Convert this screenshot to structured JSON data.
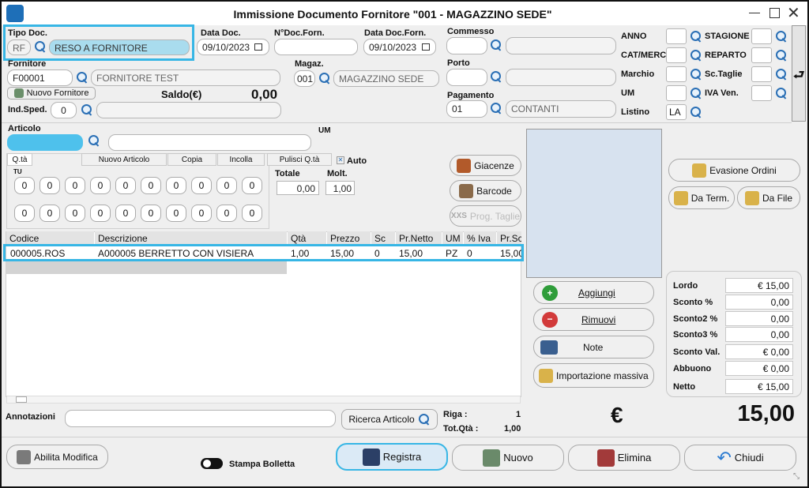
{
  "window": {
    "title": "Immissione Documento Fornitore \"001 - MAGAZZINO SEDE\""
  },
  "header": {
    "tipo_doc_label": "Tipo Doc.",
    "tipo_doc_code": "RF",
    "tipo_doc_desc": "RESO A FORNITORE",
    "data_doc_label": "Data Doc.",
    "data_doc": "09/10/2023",
    "ndoc_forn_label": "N°Doc.Forn.",
    "ndoc_forn": "",
    "data_doc_forn_label": "Data Doc.Forn.",
    "data_doc_forn": "09/10/2023",
    "commesso_label": "Commesso",
    "fornitore_label": "Fornitore",
    "fornitore_code": "F00001",
    "fornitore_desc": "FORNITORE TEST",
    "nuovo_fornitore": "Nuovo Fornitore",
    "saldo_label": "Saldo(€)",
    "saldo_value": "0,00",
    "magaz_label": "Magaz.",
    "magaz_code": "001",
    "magaz_desc": "MAGAZZINO SEDE",
    "porto_label": "Porto",
    "ind_sped_label": "Ind.Sped.",
    "ind_sped": "0",
    "pagamento_label": "Pagamento",
    "pagamento_code": "01",
    "pagamento_desc": "CONTANTI",
    "anno_label": "ANNO",
    "stagione_label": "STAGIONE",
    "catmerc_label": "CAT/MERC",
    "reparto_label": "REPARTO",
    "marchio_label": "Marchio",
    "sctaglie_label": "Sc.Taglie",
    "um_label": "UM",
    "ivaven_label": "IVA Ven.",
    "listino_label": "Listino",
    "listino": "LA"
  },
  "articolo": {
    "label": "Articolo",
    "um_label": "UM",
    "tabs": [
      "Q.tà",
      "Nuovo Articolo",
      "Copia",
      "Incolla",
      "Pulisci Q.tà"
    ],
    "auto_label": "Auto",
    "tu_label": "TU",
    "row1": [
      "0",
      "0",
      "0",
      "0",
      "0",
      "0",
      "0",
      "0",
      "0",
      "0"
    ],
    "row2": [
      "0",
      "0",
      "0",
      "0",
      "0",
      "0",
      "0",
      "0",
      "0",
      "0"
    ],
    "totale_label": "Totale",
    "totale": "0,00",
    "molt_label": "Molt.",
    "molt": "1,00",
    "giacenze": "Giacenze",
    "barcode": "Barcode",
    "prog_taglie": "Prog. Taglie"
  },
  "right_buttons": {
    "evasione": "Evasione Ordini",
    "da_term": "Da Term.",
    "da_file": "Da File"
  },
  "table": {
    "headers": [
      "Codice",
      "Descrizione",
      "Qtà",
      "Prezzo",
      "Sc",
      "Pr.Netto",
      "UM",
      "% Iva",
      "Pr.Sc"
    ],
    "rows": [
      [
        "000005.ROS",
        "A000005 BERRETTO CON VISIERA",
        "1,00",
        "15,00",
        "0",
        "15,00",
        "PZ",
        "0",
        "15,00"
      ]
    ]
  },
  "actions": {
    "aggiungi": "Aggiungi",
    "rimuovi": "Rimuovi",
    "note": "Note",
    "importazione": "Importazione massiva"
  },
  "totals": {
    "lordo_label": "Lordo",
    "lordo": "€ 15,00",
    "sconto_label": "Sconto %",
    "sconto": "0,00",
    "sconto2_label": "Sconto2 %",
    "sconto2": "0,00",
    "sconto3_label": "Sconto3 %",
    "sconto3": "0,00",
    "scontoval_label": "Sconto Val.",
    "scontoval": "€ 0,00",
    "abbuono_label": "Abbuono",
    "abbuono": "€ 0,00",
    "netto_label": "Netto",
    "netto": "€ 15,00",
    "currency": "€",
    "grand_total": "15,00"
  },
  "bottom": {
    "annotazioni_label": "Annotazioni",
    "ricerca": "Ricerca Articolo",
    "riga_label": "Riga :",
    "riga": "1",
    "totqta_label": "Tot.Qtà :",
    "totqta": "1,00",
    "abilita": "Abilita Modifica",
    "stampa_bolla": "Stampa Bolletta",
    "registra": "Registra",
    "nuovo": "Nuovo",
    "elimina": "Elimina",
    "chiudi": "Chiudi"
  }
}
